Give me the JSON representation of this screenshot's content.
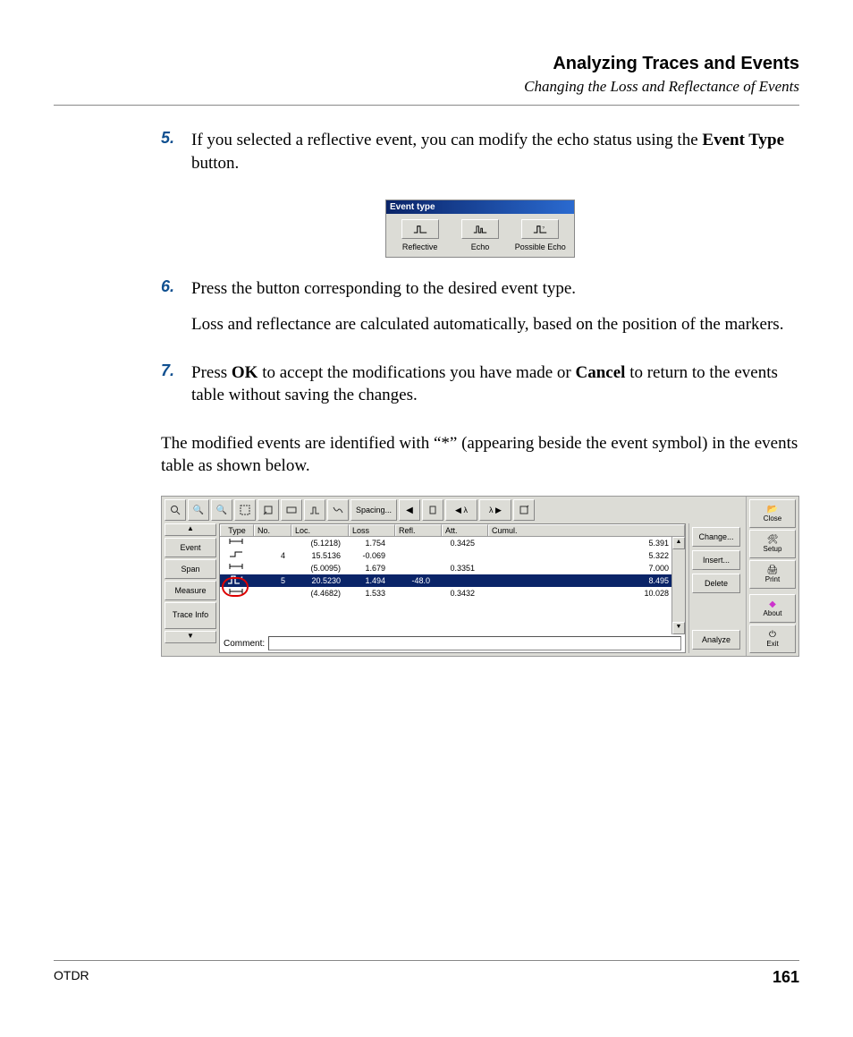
{
  "header": {
    "title": "Analyzing Traces and Events",
    "subtitle": "Changing the Loss and Reflectance of Events"
  },
  "steps": {
    "s5": {
      "num": "5.",
      "p1a": "If you selected a reflective event, you can modify the echo status using the ",
      "p1b": "Event Type",
      "p1c": " button."
    },
    "s6": {
      "num": "6.",
      "p1": "Press the button corresponding to the desired event type.",
      "p2": "Loss and reflectance are calculated automatically, based on the position of the markers."
    },
    "s7": {
      "num": "7.",
      "p1a": "Press ",
      "p1b": "OK",
      "p1c": " to accept the modifications you have made or ",
      "p1d": "Cancel",
      "p1e": " to return to the events table without saving the changes."
    }
  },
  "narrative": "The modified events are identified with “*” (appearing beside the event symbol) in the events table as shown below.",
  "eventTypeDialog": {
    "title": "Event type",
    "options": [
      {
        "label": "Reflective",
        "icon": "reflective-pulse-icon"
      },
      {
        "label": "Echo",
        "icon": "echo-pulse-icon"
      },
      {
        "label": "Possible Echo",
        "icon": "possible-echo-icon"
      }
    ]
  },
  "otdr": {
    "toolbar": {
      "spacing": "Spacing...",
      "lambda_prev": "◀ λ",
      "lambda_next": "λ ▶"
    },
    "tabs": {
      "event": "Event",
      "span": "Span",
      "measure": "Measure",
      "trace": "Trace Info"
    },
    "cols": {
      "type": "Type",
      "no": "No.",
      "loc": "Loc.",
      "loss": "Loss",
      "refl": "Refl.",
      "att": "Att.",
      "cumul": "Cumul."
    },
    "rows": [
      {
        "icon": "span-icon",
        "no": "",
        "loc": "(5.1218)",
        "loss": "1.754",
        "refl": "",
        "att": "0.3425",
        "cumul": "5.391",
        "sel": false
      },
      {
        "icon": "step-icon",
        "no": "4",
        "loc": "15.5136",
        "loss": "-0.069",
        "refl": "",
        "att": "",
        "cumul": "5.322",
        "sel": false
      },
      {
        "icon": "span-icon",
        "no": "",
        "loc": "(5.0095)",
        "loss": "1.679",
        "refl": "",
        "att": "0.3351",
        "cumul": "7.000",
        "sel": false
      },
      {
        "icon": "reflective-mod-icon",
        "no": "5",
        "loc": "20.5230",
        "loss": "1.494",
        "refl": "-48.0",
        "att": "",
        "cumul": "8.495",
        "sel": true
      },
      {
        "icon": "span-icon",
        "no": "",
        "loc": "(4.4682)",
        "loss": "1.533",
        "refl": "",
        "att": "0.3432",
        "cumul": "10.028",
        "sel": false
      }
    ],
    "comment_label": "Comment:",
    "comment_value": "",
    "rbuttons": {
      "change": "Change...",
      "insert": "Insert...",
      "delete": "Delete",
      "analyze": "Analyze"
    },
    "side": {
      "close": "Close",
      "setup": "Setup",
      "print": "Print",
      "about": "About",
      "exit": "Exit"
    }
  },
  "footer": {
    "left": "OTDR",
    "page": "161"
  }
}
